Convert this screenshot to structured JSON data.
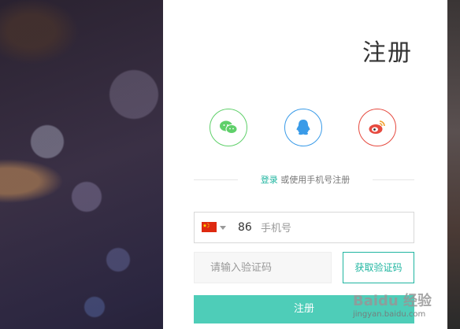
{
  "page": {
    "title": "注册"
  },
  "social": {
    "wechat_icon": "wechat-icon",
    "qq_icon": "qq-icon",
    "weibo_icon": "weibo-icon",
    "colors": {
      "wechat": "#5fd06a",
      "qq": "#3a9be8",
      "weibo": "#e64a3f"
    }
  },
  "divider": {
    "login_link": "登录",
    "text": " 或使用手机号注册"
  },
  "phone": {
    "country_flag_icon": "china-flag-icon",
    "country_code": "86",
    "placeholder": "手机号",
    "value": ""
  },
  "verify": {
    "placeholder": "请输入验证码",
    "value": "",
    "get_code_label": "获取验证码"
  },
  "submit": {
    "label": "注册"
  },
  "watermark": {
    "brand": "Baidu 经验",
    "site": "jingyan.baidu.com"
  },
  "colors": {
    "accent": "#1fb5a0",
    "submit_bg": "#4ecdb8"
  }
}
